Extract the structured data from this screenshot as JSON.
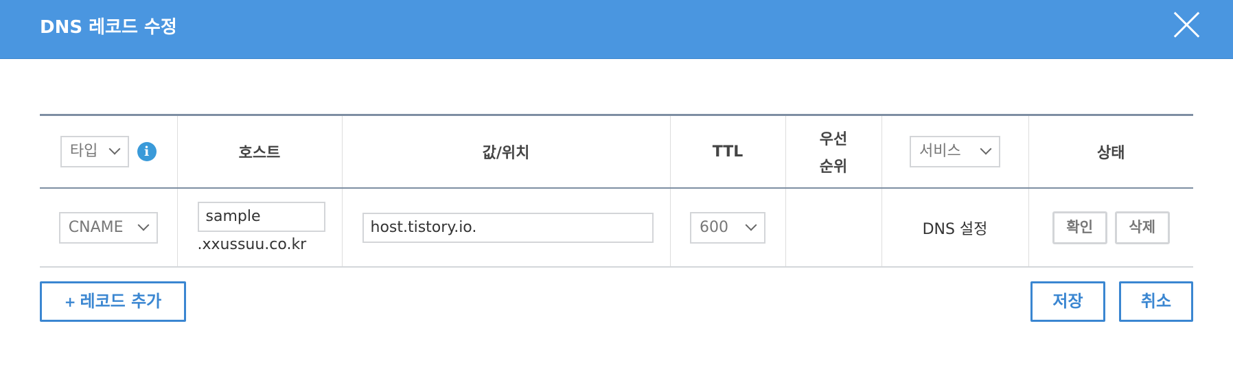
{
  "dialog": {
    "title": "DNS 레코드 수정"
  },
  "table": {
    "headers": {
      "type_select": "타입",
      "info_icon": "i",
      "host": "호스트",
      "value": "값/위치",
      "ttl": "TTL",
      "priority_line1": "우선",
      "priority_line2": "순위",
      "service_select": "서비스",
      "status": "상태"
    },
    "rows": [
      {
        "type": "CNAME",
        "host_input": "sample",
        "domain": ".xxussuu.co.kr",
        "value_input": "host.tistory.io.",
        "ttl": "600",
        "priority": "",
        "service": "DNS 설정",
        "confirm_label": "확인",
        "delete_label": "삭제"
      }
    ]
  },
  "actions": {
    "add_icon": "+",
    "add_record": "레코드 추가",
    "save": "저장",
    "cancel": "취소"
  },
  "colors": {
    "header_bg": "#4a96e0",
    "accent": "#3a86d1",
    "info_icon": "#3a9ad9"
  }
}
